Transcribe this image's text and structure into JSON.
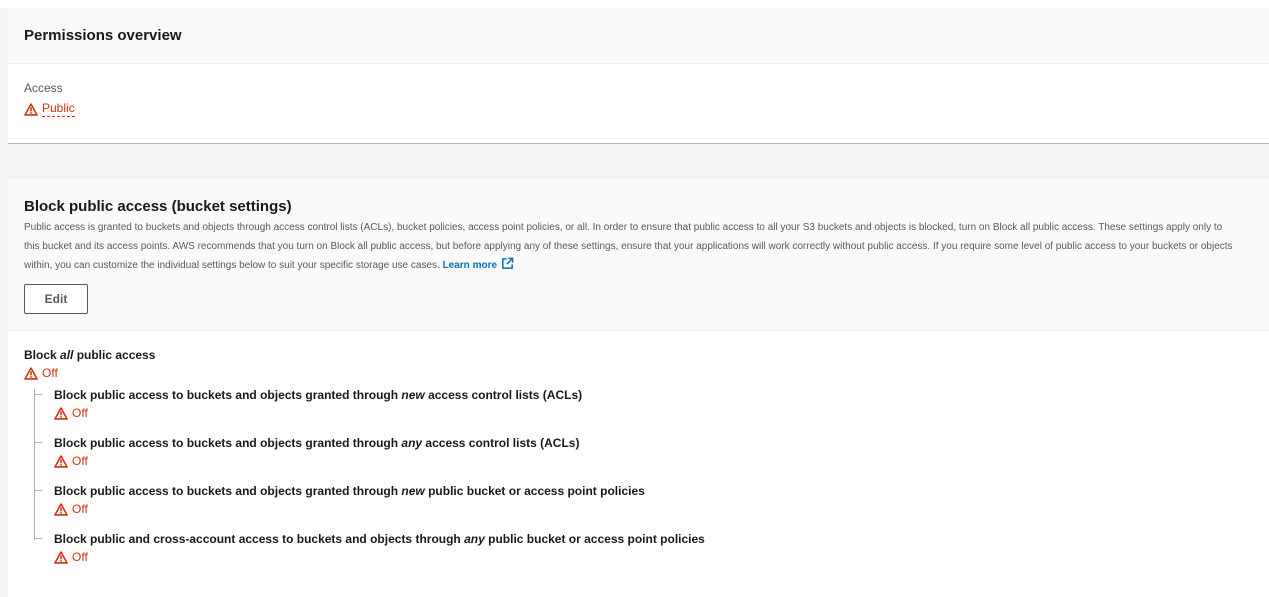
{
  "overview": {
    "title": "Permissions overview",
    "access_label": "Access",
    "access_value": "Public",
    "access_icon": "warning-icon",
    "status_color": "#d13212"
  },
  "block_public_access": {
    "title": "Block public access (bucket settings)",
    "description": "Public access is granted to buckets and objects through access control lists (ACLs), bucket policies, access point policies, or all. In order to ensure that public access to all your S3 buckets and objects is blocked, turn on Block all public access. These settings apply only to this bucket and its access points. AWS recommends that you turn on Block all public access, but before applying any of these settings, ensure that your applications will work correctly without public access. If you require some level of public access to your buckets or objects within, you can customize the individual settings below to suit your specific storage use cases.",
    "learn_more": "Learn more",
    "learn_more_icon": "external-link-icon",
    "edit_label": "Edit",
    "main_setting": {
      "title_prefix": "Block ",
      "title_em": "all",
      "title_suffix": " public access",
      "status": "Off"
    },
    "settings": [
      {
        "title_prefix": "Block public access to buckets and objects granted through ",
        "title_em": "new",
        "title_suffix": " access control lists (ACLs)",
        "status": "Off"
      },
      {
        "title_prefix": "Block public access to buckets and objects granted through ",
        "title_em": "any",
        "title_suffix": " access control lists (ACLs)",
        "status": "Off"
      },
      {
        "title_prefix": "Block public access to buckets and objects granted through ",
        "title_em": "new",
        "title_suffix": " public bucket or access point policies",
        "status": "Off"
      },
      {
        "title_prefix": "Block public and cross-account access to buckets and objects through ",
        "title_em": "any",
        "title_suffix": " public bucket or access point policies",
        "status": "Off"
      }
    ]
  },
  "colors": {
    "link": "#0073bb",
    "warning": "#d13212",
    "page_background": "#f2f3f3"
  }
}
